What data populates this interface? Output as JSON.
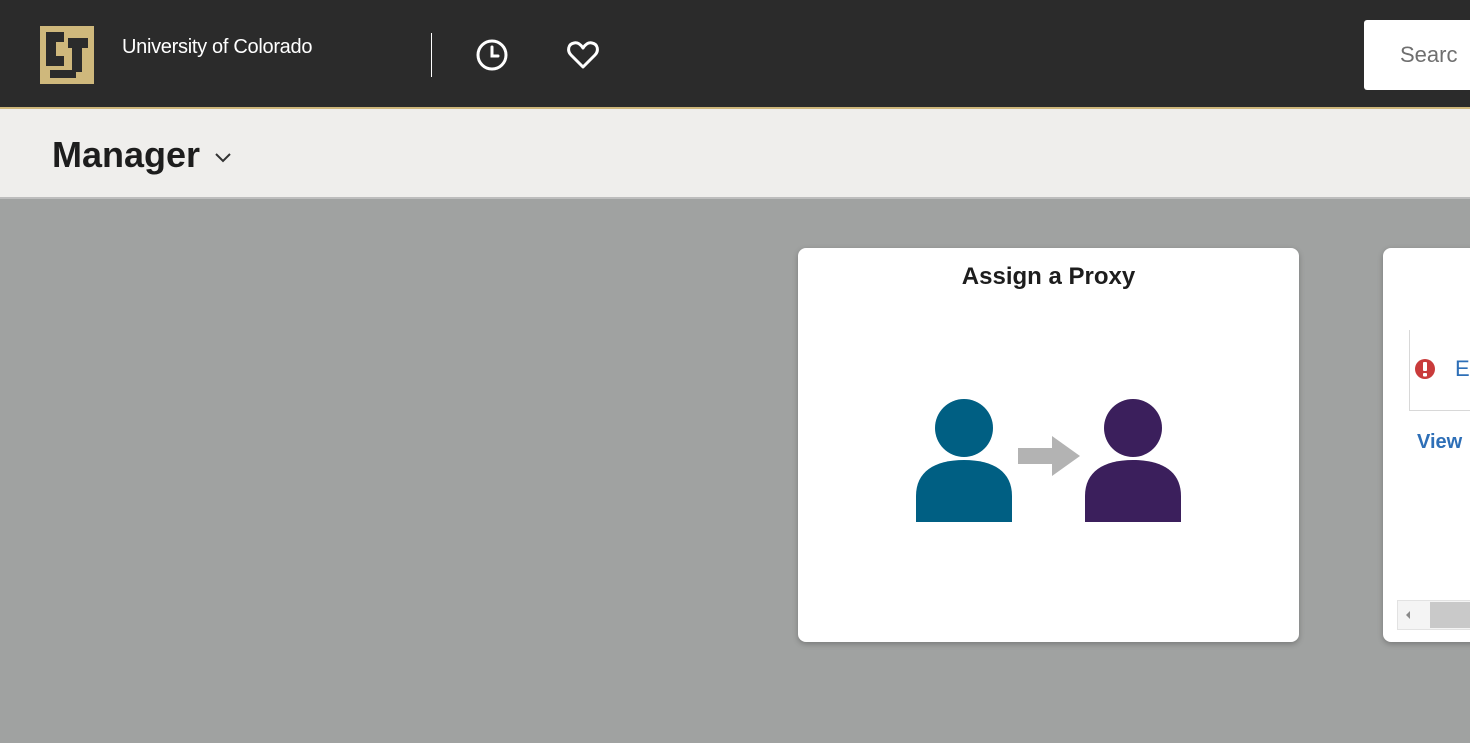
{
  "header": {
    "brand_name": "University of Colorado",
    "logo_icon": "cu-logo-icon",
    "recent_icon": "clock-icon",
    "favorites_icon": "heart-icon",
    "search_placeholder": "Searc",
    "accent_color": "#cfb87c"
  },
  "subheader": {
    "homepage_title": "Manager",
    "dropdown_icon": "chevron-down-icon"
  },
  "tiles": [
    {
      "title": "Assign a Proxy",
      "icon": "assign-proxy-icon",
      "colors": {
        "person_from": "#005f83",
        "arrow": "#b3b3b3",
        "person_to": "#3b1f5c"
      }
    },
    {
      "title": "",
      "alert_icon": "exclamation-circle-icon",
      "alert_text": "E",
      "link_text": "View"
    }
  ]
}
